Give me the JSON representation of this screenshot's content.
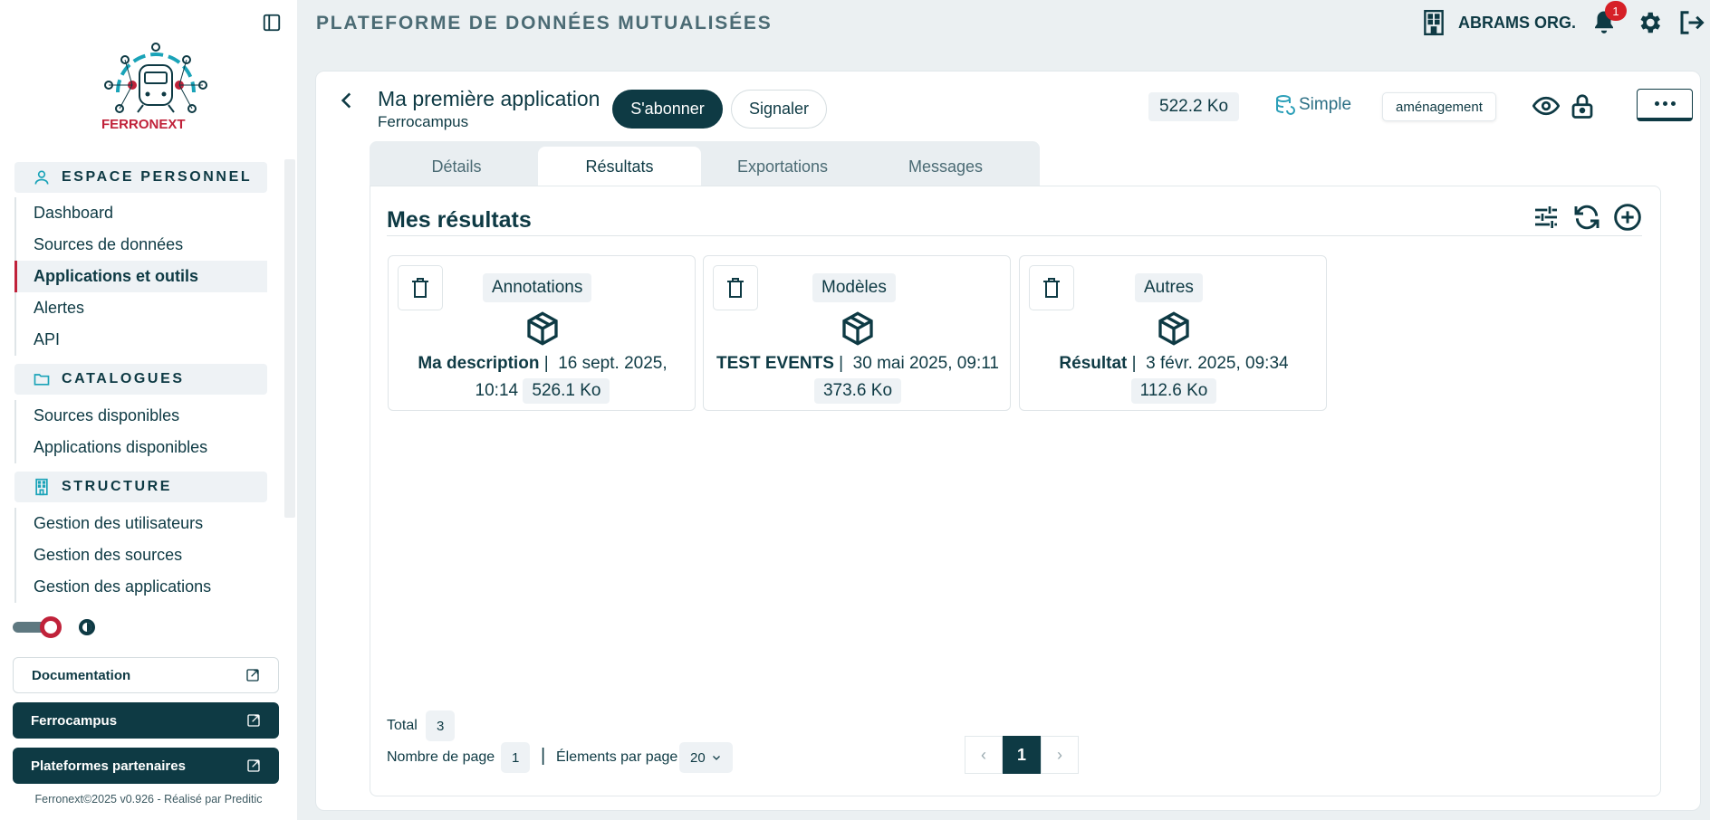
{
  "header": {
    "title": "PLATEFORME DE DONNÉES MUTUALISÉES",
    "org_name": "ABRAMS ORG.",
    "notification_count": "1"
  },
  "sidebar": {
    "logo_text": "FERRONEXT",
    "sections": [
      {
        "title": "ESPACE PERSONNEL",
        "icon": "user-icon",
        "items": [
          "Dashboard",
          "Sources de données",
          "Applications et outils",
          "Alertes",
          "API"
        ],
        "active": "Applications et outils"
      },
      {
        "title": "CATALOGUES",
        "icon": "folder-icon",
        "items": [
          "Sources disponibles",
          "Applications disponibles"
        ]
      },
      {
        "title": "STRUCTURE",
        "icon": "building-icon",
        "items": [
          "Gestion des utilisateurs",
          "Gestion des sources",
          "Gestion des applications"
        ]
      }
    ],
    "buttons": {
      "documentation": "Documentation",
      "ferrocampus": "Ferrocampus",
      "partners": "Plateformes partenaires"
    },
    "footer": "Ferronext©2025 v0.926 - Réalisé par Preditic"
  },
  "app": {
    "title": "Ma première application",
    "subtitle": "Ferrocampus",
    "subscribe_label": "S'abonner",
    "report_label": "Signaler",
    "size": "522.2 Ko",
    "mode": "Simple",
    "tag": "aménagement"
  },
  "tabs": [
    "Détails",
    "Résultats",
    "Exportations",
    "Messages"
  ],
  "active_tab": "Résultats",
  "results": {
    "title": "Mes résultats",
    "cards": [
      {
        "type": "Annotations",
        "name": "Ma description",
        "date_part1": "16 sept. 2025,",
        "date_part2": "10:14",
        "size": "526.1 Ko"
      },
      {
        "type": "Modèles",
        "name": "TEST EVENTS",
        "date_part1": "30 mai 2025, 09:11",
        "date_part2": "",
        "size": "373.6 Ko"
      },
      {
        "type": "Autres",
        "name": "Résultat",
        "date_part1": "3 févr. 2025, 09:34",
        "date_part2": "",
        "size": "112.6 Ko"
      }
    ]
  },
  "pagination": {
    "total_label": "Total",
    "total": "3",
    "pages_label": "Nombre de page",
    "pages": "1",
    "per_page_label": "Élements par page",
    "per_page": "20",
    "prev": "‹",
    "current": "1",
    "next": "›"
  },
  "colors": {
    "primary": "#0e3a44",
    "accent": "#c0223a",
    "badge": "#d62027",
    "link": "#2c6f85"
  }
}
